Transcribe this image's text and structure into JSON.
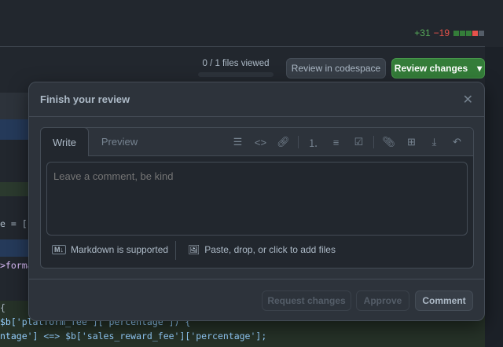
{
  "diff_stats": {
    "additions": "+31",
    "deletions": "−19",
    "blocks": [
      "#347d39",
      "#347d39",
      "#347d39",
      "#e5534b",
      "#545d68"
    ]
  },
  "toolbar": {
    "files_viewed": "0 / 1 files viewed",
    "files_viewed_progress": 0,
    "review_in_codespace": "Review in codespace",
    "review_changes": "Review changes",
    "caret": "▾"
  },
  "code_lines": [
    "e = ['",
    ">forma",
    "{",
    "$b['platform_fee']['percentage']) {",
    "ntage'] <=> $b['sales_reward_fee']['percentage'];"
  ],
  "dialog": {
    "title": "Finish your review",
    "close": "✕",
    "tabs": [
      "Write",
      "Preview"
    ],
    "toolbar_icons": [
      "heading-icon",
      "code-icon",
      "link-icon",
      "ordered-list-icon",
      "unordered-list-icon",
      "task-list-icon",
      "paperclip-icon",
      "table-icon",
      "insert-below-icon",
      "undo-icon"
    ],
    "placeholder": "Leave a comment, be kind",
    "markdown_note": "Markdown is supported",
    "attach_note": "Paste, drop, or click to add files",
    "actions": {
      "request_changes": "Request changes",
      "approve": "Approve",
      "comment": "Comment"
    }
  }
}
